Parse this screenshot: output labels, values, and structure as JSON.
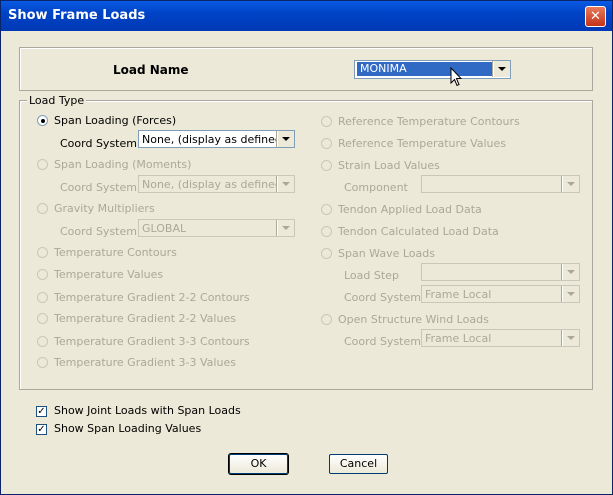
{
  "window": {
    "title": "Show Frame Loads",
    "close_symbol": "✕"
  },
  "load_name": {
    "label": "Load Name",
    "selected": "MONIMA"
  },
  "load_type": {
    "legend": "Load Type",
    "span_forces": {
      "label": "Span Loading (Forces)",
      "coord_label": "Coord System",
      "coord_value": "None, (display as defined)"
    },
    "span_moments": {
      "label": "Span Loading (Moments)",
      "coord_label": "Coord System",
      "coord_value": "None, (display as defined)"
    },
    "gravity": {
      "label": "Gravity Multipliers",
      "coord_label": "Coord System",
      "coord_value": "GLOBAL"
    },
    "temp_contours": "Temperature Contours",
    "temp_values": "Temperature Values",
    "tg22_contours": "Temperature Gradient 2-2 Contours",
    "tg22_values": "Temperature Gradient 2-2 Values",
    "tg33_contours": "Temperature Gradient 3-3 Contours",
    "tg33_values": "Temperature Gradient 3-3 Values",
    "ref_temp_contours": "Reference Temperature Contours",
    "ref_temp_values": "Reference Temperature Values",
    "strain": {
      "label": "Strain Load Values",
      "component_label": "Component",
      "component_value": ""
    },
    "tendon_applied": "Tendon Applied Load Data",
    "tendon_calculated": "Tendon Calculated Load Data",
    "span_wave": {
      "label": "Span Wave Loads",
      "load_step_label": "Load Step",
      "load_step_value": "",
      "coord_label": "Coord System",
      "coord_value": "Frame Local"
    },
    "open_wind": {
      "label": "Open Structure Wind Loads",
      "coord_label": "Coord System",
      "coord_value": "Frame Local"
    }
  },
  "options": {
    "show_joint_loads": {
      "label": "Show Joint Loads with Span Loads",
      "checked": true
    },
    "show_span_values": {
      "label": "Show Span Loading Values",
      "checked": true
    }
  },
  "buttons": {
    "ok": "OK",
    "cancel": "Cancel"
  }
}
